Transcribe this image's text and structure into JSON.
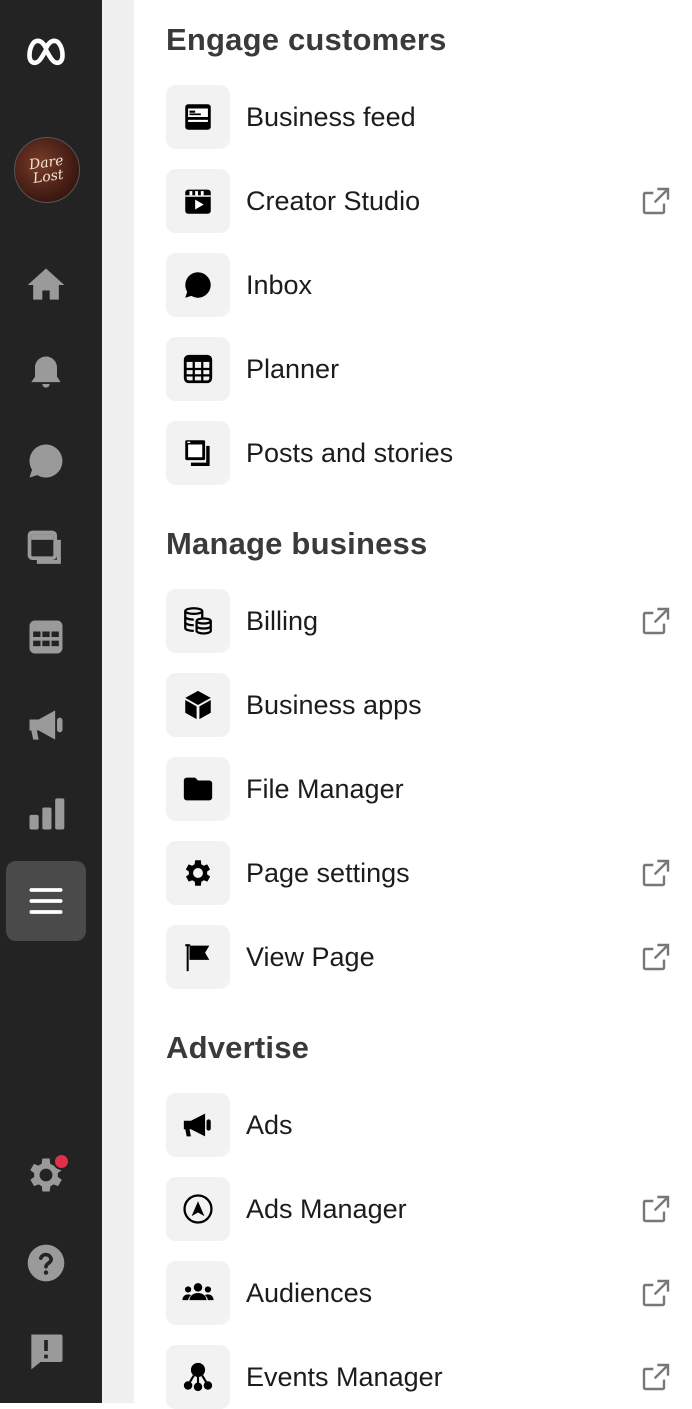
{
  "rail": {
    "items": [
      {
        "icon": "meta-logo-icon"
      },
      {
        "icon": "avatar",
        "text_line1": "Dare",
        "text_line2": "Lost"
      },
      {
        "icon": "home-icon"
      },
      {
        "icon": "bell-icon"
      },
      {
        "icon": "chat-bubble-icon"
      },
      {
        "icon": "posts-icon"
      },
      {
        "icon": "planner-grid-icon"
      },
      {
        "icon": "megaphone-icon"
      },
      {
        "icon": "insights-bar-chart-icon"
      },
      {
        "icon": "menu-hamburger-icon",
        "active": true
      },
      {
        "icon": "settings-gear-icon",
        "badge": true
      },
      {
        "icon": "help-icon"
      },
      {
        "icon": "feedback-icon"
      }
    ]
  },
  "sections": [
    {
      "title": "Engage customers",
      "items": [
        {
          "label": "Business feed",
          "icon": "business-feed-icon",
          "external": false
        },
        {
          "label": "Creator Studio",
          "icon": "creator-studio-icon",
          "external": true
        },
        {
          "label": "Inbox",
          "icon": "inbox-icon",
          "external": false
        },
        {
          "label": "Planner",
          "icon": "planner-icon",
          "external": false
        },
        {
          "label": "Posts and stories",
          "icon": "posts-stories-icon",
          "external": false
        }
      ]
    },
    {
      "title": "Manage business",
      "items": [
        {
          "label": "Billing",
          "icon": "billing-icon",
          "external": true
        },
        {
          "label": "Business apps",
          "icon": "business-apps-icon",
          "external": false
        },
        {
          "label": "File Manager",
          "icon": "folder-icon",
          "external": false
        },
        {
          "label": "Page settings",
          "icon": "gear-icon",
          "external": true
        },
        {
          "label": "View Page",
          "icon": "flag-icon",
          "external": true
        }
      ]
    },
    {
      "title": "Advertise",
      "items": [
        {
          "label": "Ads",
          "icon": "megaphone-icon",
          "external": false
        },
        {
          "label": "Ads Manager",
          "icon": "ads-manager-icon",
          "external": true
        },
        {
          "label": "Audiences",
          "icon": "audiences-icon",
          "external": true
        },
        {
          "label": "Events Manager",
          "icon": "events-manager-icon",
          "external": true
        }
      ]
    }
  ],
  "colors": {
    "rail_bg": "#232323",
    "rail_icon": "#9a9a9a",
    "active_bg": "#4a4a4a",
    "badge": "#e0304a"
  }
}
